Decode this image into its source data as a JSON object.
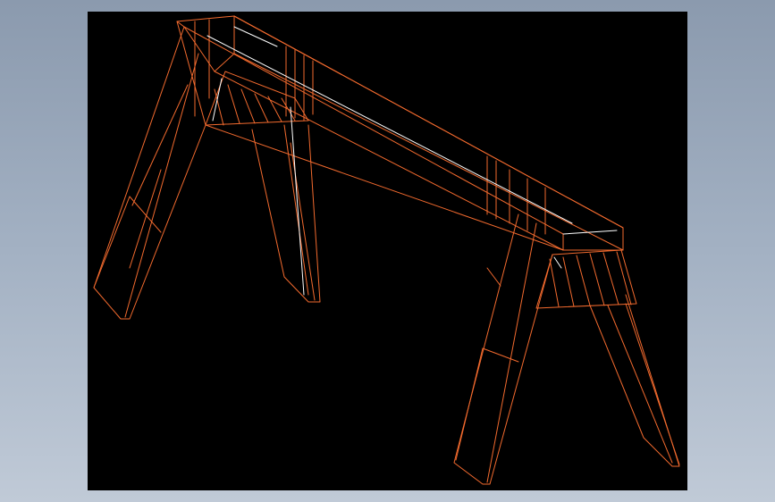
{
  "model": {
    "wire_color": "#f26a2e",
    "highlight_color": "#ffffff",
    "viewport_background": "#000000",
    "window_background": "#9eabbd"
  }
}
